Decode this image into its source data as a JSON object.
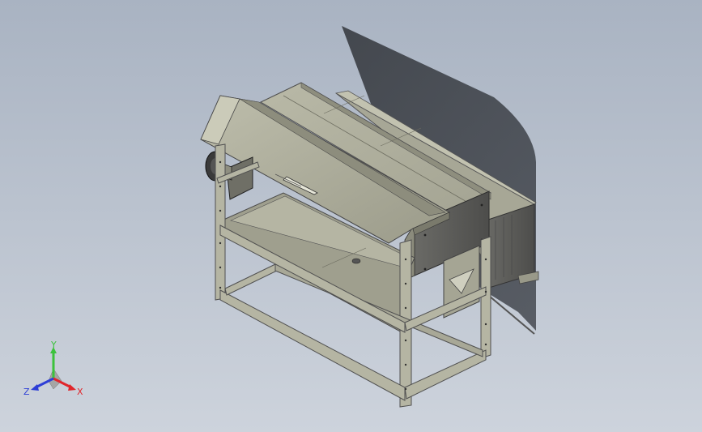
{
  "viewport": {
    "background_top": "#a9b3c2",
    "background_bottom": "#cdd3dc"
  },
  "model": {
    "frame_color": "#b5b5a3",
    "sheet_color": "#a9a998",
    "shadow_color": "#2e3136",
    "dark_panel_color": "#5a5a58"
  },
  "triad": {
    "x_label": "X",
    "y_label": "Y",
    "z_label": "Z",
    "x_color": "#e0262b",
    "y_color": "#3cc23c",
    "z_color": "#2d3ed6"
  }
}
